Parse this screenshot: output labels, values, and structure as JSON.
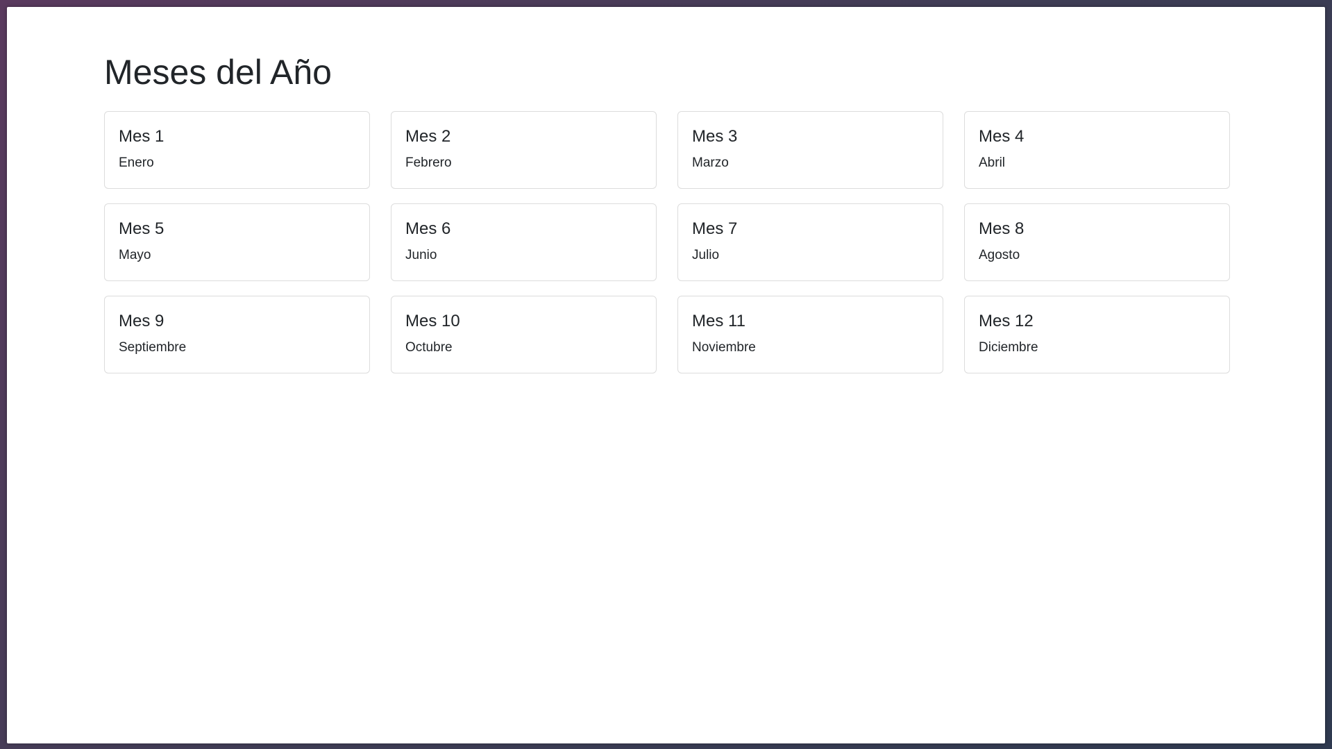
{
  "page": {
    "title": "Meses del Año"
  },
  "months": [
    {
      "label": "Mes 1",
      "name": "Enero"
    },
    {
      "label": "Mes 2",
      "name": "Febrero"
    },
    {
      "label": "Mes 3",
      "name": "Marzo"
    },
    {
      "label": "Mes 4",
      "name": "Abril"
    },
    {
      "label": "Mes 5",
      "name": "Mayo"
    },
    {
      "label": "Mes 6",
      "name": "Junio"
    },
    {
      "label": "Mes 7",
      "name": "Julio"
    },
    {
      "label": "Mes 8",
      "name": "Agosto"
    },
    {
      "label": "Mes 9",
      "name": "Septiembre"
    },
    {
      "label": "Mes 10",
      "name": "Octubre"
    },
    {
      "label": "Mes 11",
      "name": "Noviembre"
    },
    {
      "label": "Mes 12",
      "name": "Diciembre"
    }
  ],
  "colors": {
    "text": "#212529",
    "card_border": "#dcdcdc",
    "background": "#ffffff"
  }
}
